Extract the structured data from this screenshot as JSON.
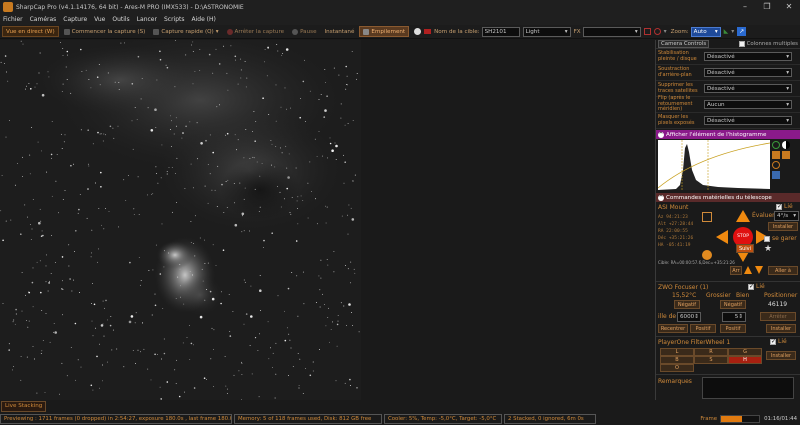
{
  "window": {
    "title": "SharpCap Pro (v4.1.14176, 64 bit) - Ares-M PRO (IMX533) - D:\\ASTRONOMIE"
  },
  "menu": [
    "Fichier",
    "Caméras",
    "Capture",
    "Vue",
    "Outils",
    "Lancer",
    "Scripts",
    "Aide (H)"
  ],
  "toolbar": {
    "live_view": "Vue en direct (W)",
    "start_capture": "Commencer la capture (S)",
    "quick_capture": "Capture rapide (Q)",
    "stop_capture": "Arrêter la capture",
    "pause": "Pause",
    "snapshot": "Instantané",
    "stacking": "Empilement",
    "target_label": "Nom de la cible:",
    "target_value": "SH2101",
    "frame_type": "Light",
    "fx_label": "FX",
    "zoom_label": "Zoom:",
    "zoom_value": "Auto"
  },
  "panel": {
    "tab": "Camera Controls",
    "multi_columns": "Colonnes multiples",
    "settings": [
      {
        "label": "Stabilisation pleinte / disque",
        "value": "Désactivé"
      },
      {
        "label": "Soustraction d'arrière-plan",
        "value": "Désactivé"
      },
      {
        "label": "Supprimer les traces satellites",
        "value": "Désactivé"
      },
      {
        "label": "Flip (après le retournement méridien)",
        "value": "Aucun"
      },
      {
        "label": "Masquer les pixels exposés",
        "value": "Désactivé"
      }
    ],
    "histogram_title": "Afficher l'élément de l'histogramme",
    "telescope_title": "Commandes matérielles du télescope",
    "mount": {
      "name": "ASI Mount",
      "connected_label": "Lié",
      "eval_label": "Évaluer:",
      "eval_value": "4°/s",
      "install": "Installer",
      "park": "se garer",
      "follow": "Suivi",
      "stop": "Arr",
      "goto": "Aller à",
      "coords": [
        "Az 94:21:23",
        "Alt +27:28:44",
        "RA 22:00:55",
        "Déc +35:21:26",
        "HA -05:41:19"
      ],
      "status": "Cible: RA=00:00:57.6,Dec=+35:21:26"
    },
    "focuser": {
      "name": "ZWO Focuser (1)",
      "connected_label": "Lié",
      "temp": "15,52°C",
      "coarse": "Grossier",
      "fine": "Bien",
      "positioner": "Positionner",
      "negative1": "Négatif",
      "negative2": "Négatif",
      "position_value": "46119",
      "step_label": "ille de pas",
      "step_coarse": "6000",
      "step_fine": "5",
      "stop": "Arrêter",
      "recenter": "Recentrer",
      "positive1": "Positif",
      "positive2": "Positif",
      "install": "Installer"
    },
    "filterwheel": {
      "name": "PlayerOne FilterWheel 1",
      "connected_label": "Lié",
      "filters": [
        "L",
        "R",
        "G",
        "B",
        "S",
        "H",
        "O"
      ],
      "active": "H",
      "install": "Installer"
    },
    "notes_label": "Remarques"
  },
  "live_stacking": "Live Stacking",
  "status": {
    "preview": "Previewing : 1711 frames (0 dropped) in 2:54:27, exposure 180.0s , last frame 180.0s",
    "memory": "Memory: 5 of 118 frames used, Disk: 812 GB free",
    "cooler": "Cooler: 5%, Temp: -5,0°C, Target: -5,0°C",
    "stacked": "2 Stacked, 0 ignored, 6m 0s",
    "frame_label": "Frame",
    "frame_progress": 0.55,
    "time": "01:16/01:44"
  },
  "colors": {
    "accent": "#d08a3a",
    "histogram_header": "#8a1a8a",
    "telescope_header": "#5a2a2a",
    "filter_active": "#a82010"
  }
}
